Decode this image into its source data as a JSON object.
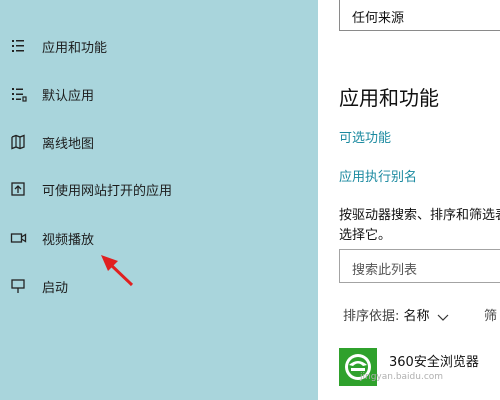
{
  "sidebar": {
    "items": [
      {
        "label": "应用和功能",
        "icon": "apps-list-icon"
      },
      {
        "label": "默认应用",
        "icon": "default-apps-icon"
      },
      {
        "label": "离线地图",
        "icon": "offline-map-icon"
      },
      {
        "label": "可使用网站打开的应用",
        "icon": "open-in-icon"
      },
      {
        "label": "视频播放",
        "icon": "video-icon"
      },
      {
        "label": "启动",
        "icon": "startup-icon"
      }
    ]
  },
  "main": {
    "source_select_value": "任何来源",
    "section_title": "应用和功能",
    "links": [
      "可选功能",
      "应用执行别名"
    ],
    "description": "按驱动器搜索、排序和筛选表中选择它。",
    "search_placeholder": "搜索此列表",
    "sort_label": "排序依据:",
    "sort_value": "名称",
    "filter_fragment": "筛",
    "apps": [
      {
        "name": "360安全浏览器"
      }
    ]
  },
  "watermark": "jingyan.baidu.com",
  "colors": {
    "sidebar_bg": "#a9d5dc",
    "link": "#1b8aa0",
    "arrow": "#e02020",
    "app_icon": "#2fa12c"
  }
}
